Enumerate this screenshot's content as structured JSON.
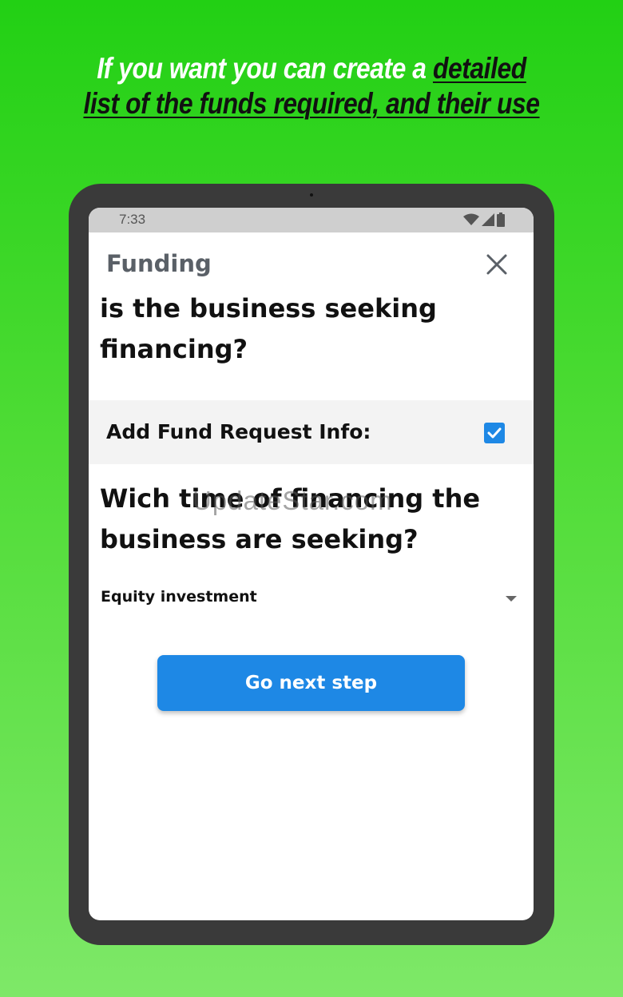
{
  "headline": {
    "part1": "If you want you can create a ",
    "highlight1": "detailed",
    "highlight2": "list of the funds required, and their use"
  },
  "status_bar": {
    "time": "7:33"
  },
  "app_bar": {
    "title": "Funding"
  },
  "form": {
    "question1": "is the business seeking financing?",
    "fund_request_label": "Add Fund Request Info:",
    "fund_request_checked": true,
    "question2": "Wich time of financing the business are seeking?",
    "financing_type_selected": "Equity investment",
    "next_button_label": "Go next step"
  },
  "watermark": "UpdateStar.com",
  "colors": {
    "accent": "#1e88e5",
    "background": "#22d014",
    "device": "#3a3a3a"
  },
  "icons": {
    "close": "close-icon",
    "checkbox": "check-icon",
    "dropdown": "caret-down-icon",
    "wifi": "wifi-icon",
    "signal": "signal-icon",
    "battery": "battery-icon"
  }
}
